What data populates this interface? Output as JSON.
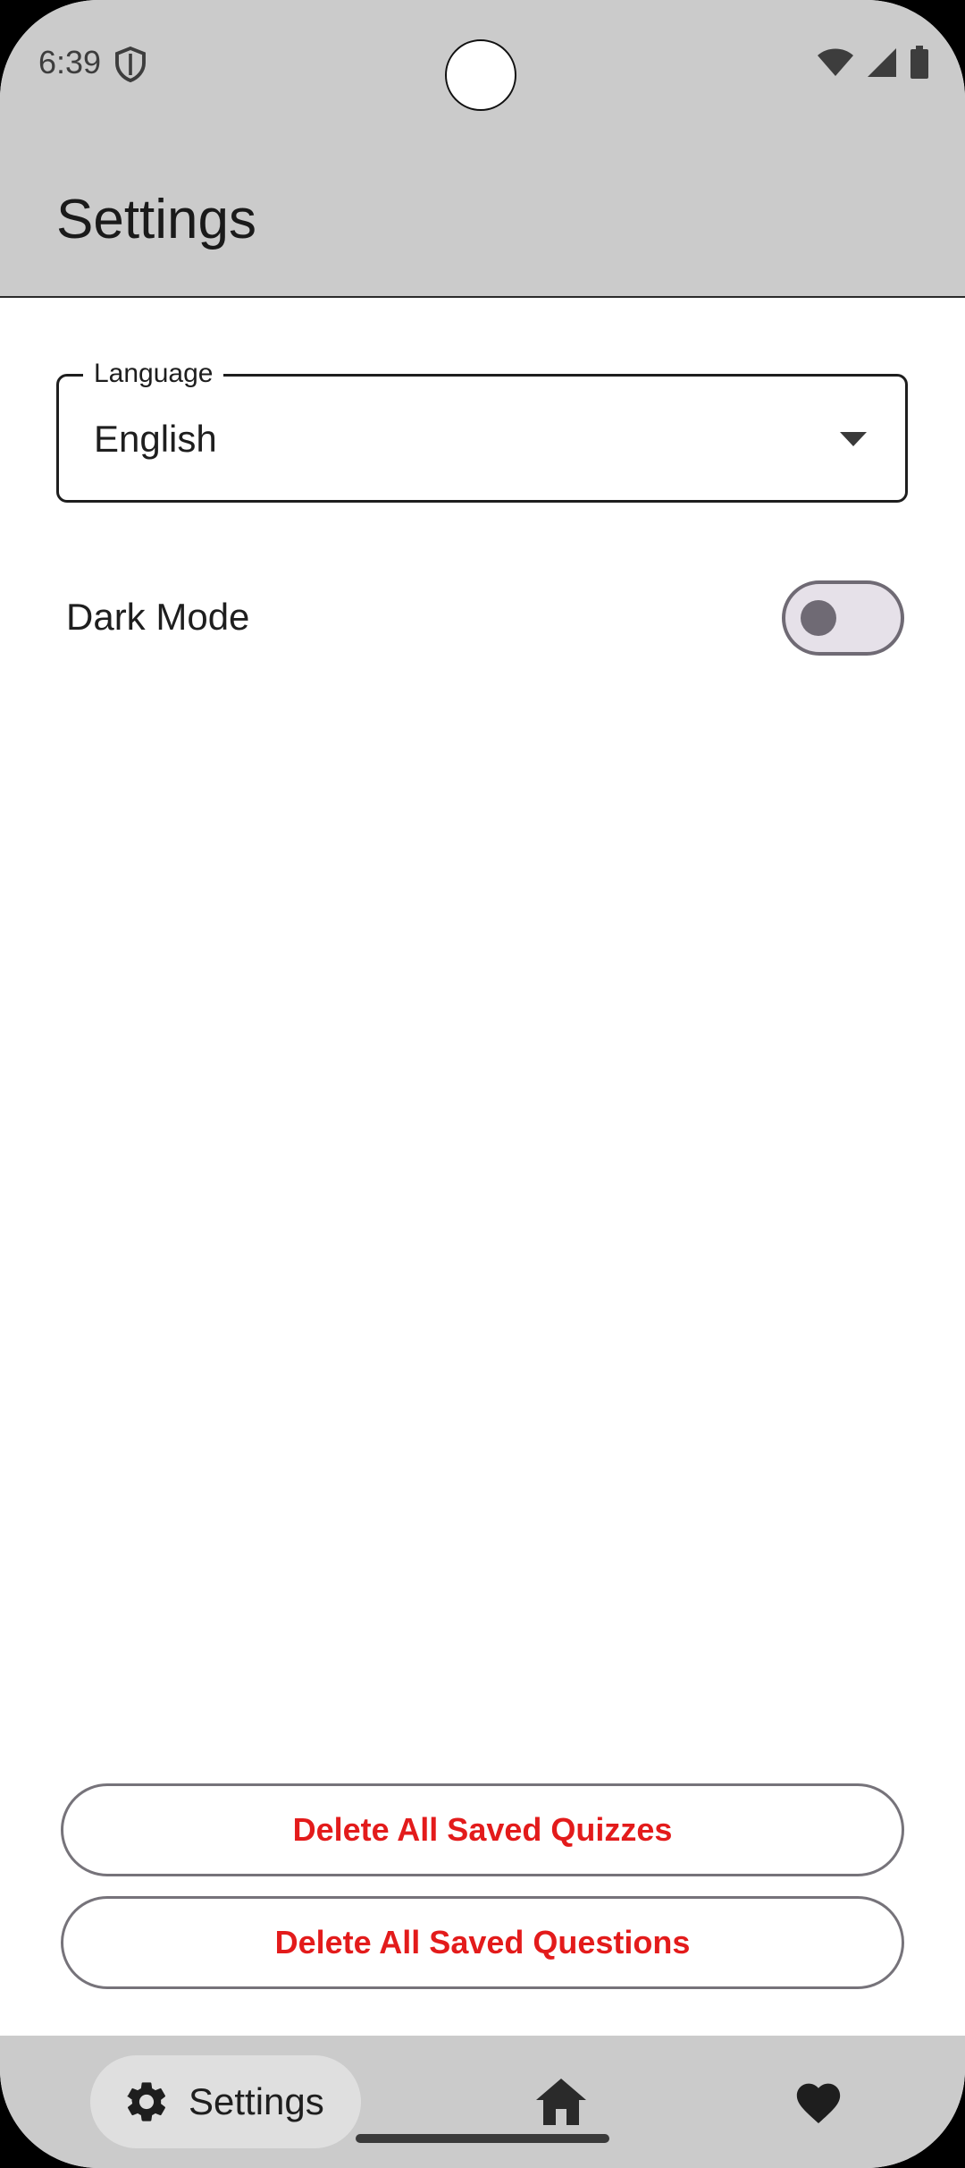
{
  "status_bar": {
    "time": "6:39",
    "icons": [
      "shield-icon",
      "wifi-icon",
      "signal-icon",
      "battery-icon"
    ]
  },
  "header": {
    "title": "Settings"
  },
  "language": {
    "label": "Language",
    "value": "English"
  },
  "dark_mode": {
    "label": "Dark Mode",
    "enabled": false
  },
  "actions": {
    "delete_quizzes": "Delete All Saved Quizzes",
    "delete_questions": "Delete All Saved Questions"
  },
  "bottom_nav": {
    "items": [
      {
        "label": "Settings",
        "icon": "gear-icon",
        "selected": true
      },
      {
        "label": "",
        "icon": "home-icon",
        "selected": false
      },
      {
        "label": "",
        "icon": "heart-icon",
        "selected": false
      }
    ]
  },
  "colors": {
    "danger": "#e31b1b",
    "bar_background": "#cbcbcb"
  }
}
